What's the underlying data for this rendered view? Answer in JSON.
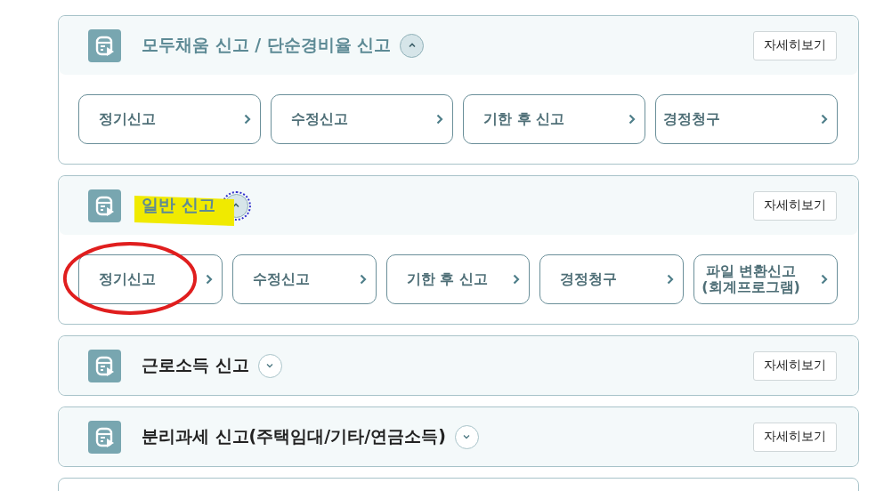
{
  "sections": [
    {
      "title": "모두채움 신고 / 단순경비율 신고",
      "expanded": true,
      "highlighted": false,
      "toggle_focused": false,
      "detail_button": "자세히보기",
      "options": [
        {
          "label": "정기신고",
          "circled": false
        },
        {
          "label": "수정신고",
          "circled": false
        },
        {
          "label": "기한 후 신고",
          "circled": false
        },
        {
          "label": "경정청구",
          "circled": false
        }
      ]
    },
    {
      "title": "일반 신고",
      "expanded": true,
      "highlighted": true,
      "toggle_focused": true,
      "detail_button": "자세히보기",
      "options": [
        {
          "label": "정기신고",
          "circled": true
        },
        {
          "label": "수정신고",
          "circled": false
        },
        {
          "label": "기한 후 신고",
          "circled": false
        },
        {
          "label": "경정청구",
          "circled": false
        },
        {
          "label": "파일 변환신고\n(회계프로그램)",
          "circled": false
        }
      ]
    },
    {
      "title": "근로소득 신고",
      "expanded": false,
      "highlighted": false,
      "toggle_focused": false,
      "detail_button": "자세히보기"
    },
    {
      "title": "분리과세 신고(주택임대/기타/연금소득)",
      "expanded": false,
      "highlighted": false,
      "toggle_focused": false,
      "detail_button": "자세히보기"
    }
  ]
}
